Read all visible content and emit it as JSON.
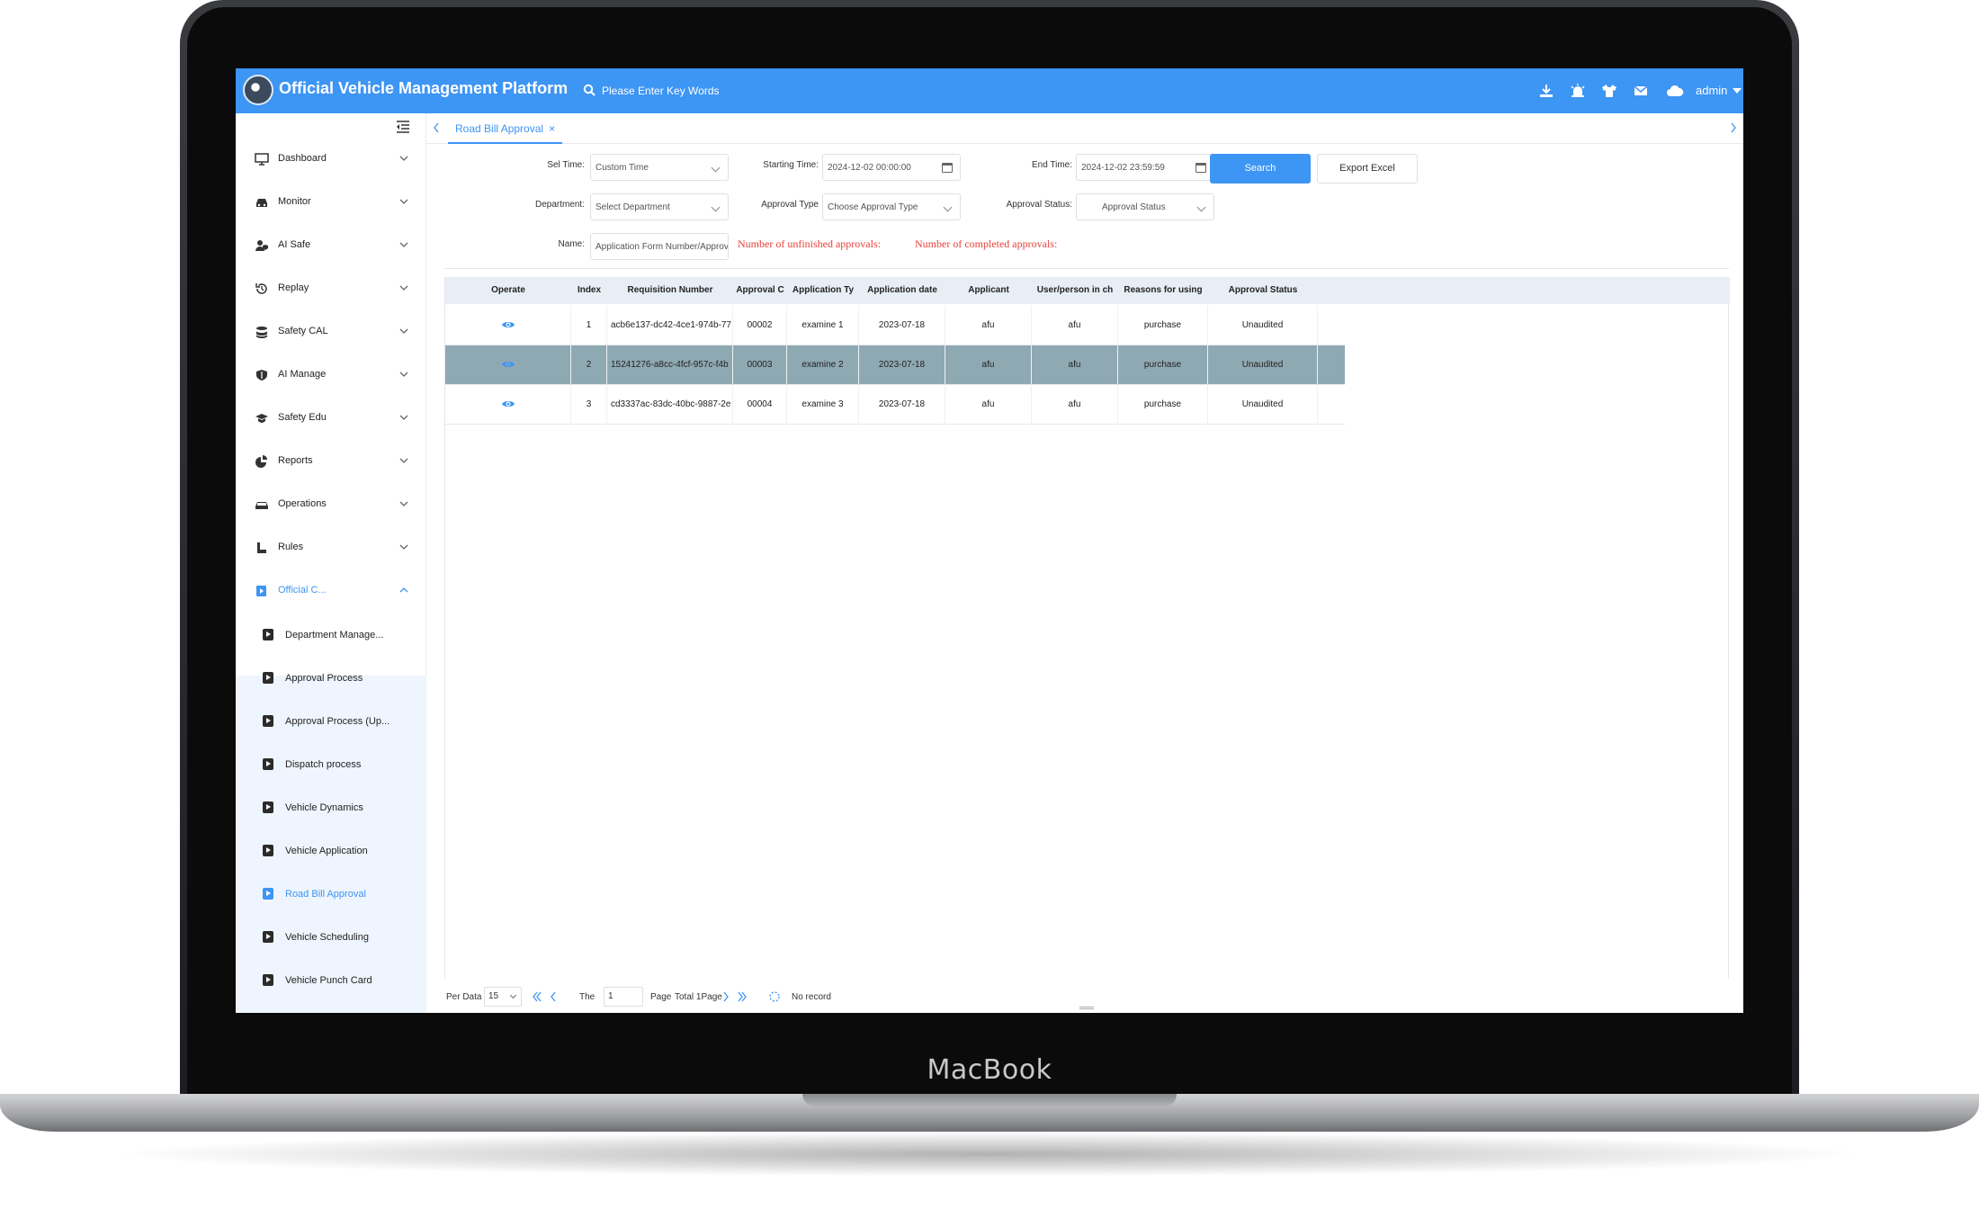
{
  "device": {
    "brand": "MacBook"
  },
  "header": {
    "title": "Official Vehicle Management Platform",
    "search_placeholder": "Please Enter Key Words",
    "user": "admin",
    "icons": [
      "download-icon",
      "alarm-icon",
      "shirt-icon",
      "mail-icon",
      "cloud-icon"
    ]
  },
  "sidebar": {
    "items": [
      {
        "label": "Dashboard",
        "icon": "dashboard-icon"
      },
      {
        "label": "Monitor",
        "icon": "car-icon"
      },
      {
        "label": "AI Safe",
        "icon": "user-shield-icon"
      },
      {
        "label": "Replay",
        "icon": "history-icon"
      },
      {
        "label": "Safety CAL",
        "icon": "stack-icon"
      },
      {
        "label": "AI Manage",
        "icon": "shield-icon"
      },
      {
        "label": "Safety Edu",
        "icon": "graduation-cap-icon"
      },
      {
        "label": "Reports",
        "icon": "pie-chart-icon"
      },
      {
        "label": "Operations",
        "icon": "vehicle-icon"
      },
      {
        "label": "Rules",
        "icon": "boot-icon"
      },
      {
        "label": "Official C...",
        "icon": "flag-icon"
      }
    ],
    "subitems": [
      {
        "label": "Department Manage..."
      },
      {
        "label": "Approval Process"
      },
      {
        "label": "Approval Process (Up..."
      },
      {
        "label": "Dispatch process"
      },
      {
        "label": "Vehicle Dynamics"
      },
      {
        "label": "Vehicle Application"
      },
      {
        "label": "Road Bill Approval"
      },
      {
        "label": "Vehicle Scheduling"
      },
      {
        "label": "Vehicle Punch Card"
      }
    ]
  },
  "tabs": [
    {
      "label": "Road Bill Approval",
      "close": "×"
    }
  ],
  "filters": {
    "sel_time_label": "Sel Time:",
    "sel_time_value": "Custom Time",
    "start_label": "Starting Time:",
    "start_value": "2024-12-02 00:00:00",
    "end_label": "End Time:",
    "end_value": "2024-12-02 23:59:59",
    "dept_label": "Department:",
    "dept_placeholder": "Select Department",
    "type_label": "Approval Type",
    "type_placeholder": "Choose Approval Type",
    "status_label": "Approval Status:",
    "status_placeholder": "Approval Status",
    "name_label": "Name:",
    "name_placeholder": "Application Form Number/Approval",
    "search_btn": "Search",
    "export_btn": "Export Excel",
    "unfinished_text": "Number of unfinished approvals:",
    "completed_text": "Number of completed approvals:"
  },
  "table": {
    "headers": [
      "Operate",
      "Index",
      "Requisition Number",
      "Approval C",
      "Application Ty",
      "Application date",
      "Applicant",
      "User/person in ch",
      "Reasons for using",
      "Approval Status"
    ],
    "rows": [
      [
        "1",
        "acb6e137-dc42-4ce1-974b-77",
        "00002",
        "examine 1",
        "2023-07-18",
        "afu",
        "afu",
        "purchase",
        "Unaudited"
      ],
      [
        "2",
        "15241276-a8cc-4fcf-957c-f4b",
        "00003",
        "examine 2",
        "2023-07-18",
        "afu",
        "afu",
        "purchase",
        "Unaudited"
      ],
      [
        "3",
        "cd3337ac-83dc-40bc-9887-2e",
        "00004",
        "examine 3",
        "2023-07-18",
        "afu",
        "afu",
        "purchase",
        "Unaudited"
      ]
    ],
    "selected_row": 2
  },
  "pagination": {
    "per_label": "Per Data",
    "per_value": "15",
    "the_label": "The",
    "page_value": "1",
    "page_label": "Page",
    "total_label": "Total 1Page",
    "status": "No record"
  },
  "colors": {
    "primary": "#3d95f4",
    "warning": "#e8403a",
    "selected_row": "#8fa9b3"
  }
}
